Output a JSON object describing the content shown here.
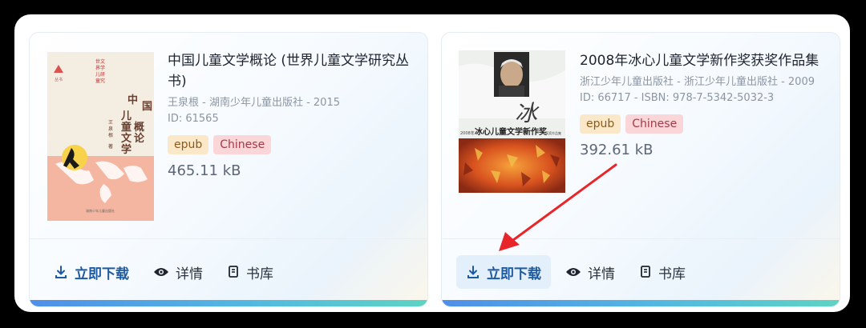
{
  "books": [
    {
      "title": "中国儿童文学概论 (世界儿童文学研究丛书)",
      "meta_line": "王泉根 - 湖南少年儿童出版社 - 2015",
      "id_line": "ID: 61565",
      "format": "epub",
      "language": "Chinese",
      "size": "465.11 kB",
      "cover": {
        "title_vertical": "中国儿童文学概论",
        "author": "王泉根 著",
        "series": "世界儿童文学研究丛书"
      }
    },
    {
      "title": "2008年冰心儿童文学新作奖获奖作品集",
      "meta_line": "浙江少年儿童出版社 - 浙江少年儿童出版社 - 2009",
      "id_line": "ID: 66717 - ISBN: 978-7-5342-5032-3",
      "format": "epub",
      "language": "Chinese",
      "size": "392.61 kB",
      "cover": {
        "title": "2008年冰心儿童文学新作奖获奖作品集"
      }
    }
  ],
  "actions": {
    "download_label": "立即下载",
    "details_label": "详情",
    "library_label": "书库"
  },
  "annotation": {
    "type": "red-arrow",
    "target": "download-button-book-2",
    "color": "#e8262a"
  }
}
